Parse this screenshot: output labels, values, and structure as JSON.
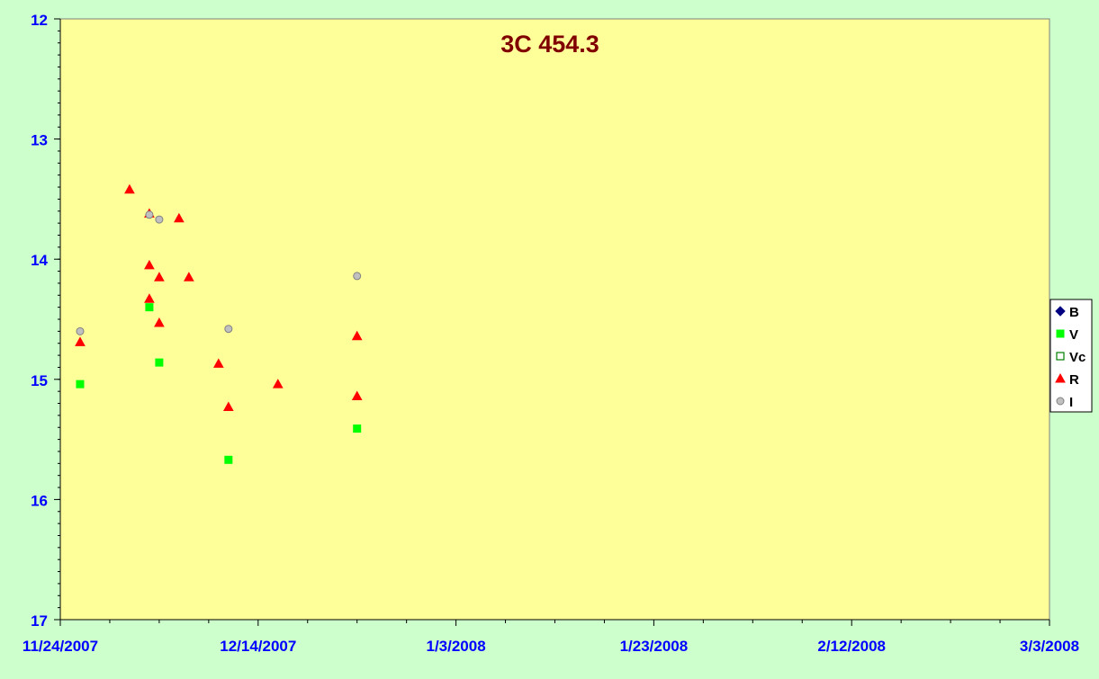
{
  "chart_data": {
    "type": "scatter",
    "title": "3C 454.3",
    "xlabel": "",
    "ylabel": "",
    "x_axis": {
      "type": "date",
      "min": "11/24/2007",
      "max": "3/3/2008",
      "major_tick_labels": [
        "11/24/2007",
        "12/14/2007",
        "1/3/2008",
        "1/23/2008",
        "2/12/2008",
        "3/3/2008"
      ],
      "minor_ticks_per_major": 4
    },
    "y_axis": {
      "min": 12,
      "max": 17,
      "reversed": true,
      "major_tick_labels": [
        "12",
        "13",
        "14",
        "15",
        "16",
        "17"
      ],
      "minor_step": 0.1
    },
    "grid": false,
    "legend_placement": "right",
    "colors": {
      "page_background": "#ccffcc",
      "plot_background": "#ffff99",
      "title": "#800000",
      "tick_labels": "#0000ff",
      "B": "#000080",
      "V": "#00ff00",
      "Vc": "#008000",
      "R": "#ff0000",
      "I": "#c0c0c0"
    },
    "series": [
      {
        "name": "B",
        "marker": "diamond",
        "points": []
      },
      {
        "name": "V",
        "marker": "square",
        "points": [
          {
            "x": "11/26/2007",
            "y": 15.04
          },
          {
            "x": "12/3/2007",
            "y": 14.4
          },
          {
            "x": "12/4/2007",
            "y": 14.86
          },
          {
            "x": "12/11/2007",
            "y": 15.67
          },
          {
            "x": "12/24/2007",
            "y": 15.41
          }
        ]
      },
      {
        "name": "Vc",
        "marker": "square-open",
        "points": []
      },
      {
        "name": "R",
        "marker": "triangle",
        "points": [
          {
            "x": "11/26/2007",
            "y": 14.69
          },
          {
            "x": "12/1/2007",
            "y": 13.42
          },
          {
            "x": "12/3/2007",
            "y": 13.62
          },
          {
            "x": "12/3/2007",
            "y": 14.05
          },
          {
            "x": "12/3/2007",
            "y": 14.33
          },
          {
            "x": "12/4/2007",
            "y": 14.15
          },
          {
            "x": "12/4/2007",
            "y": 14.53
          },
          {
            "x": "12/6/2007",
            "y": 13.66
          },
          {
            "x": "12/7/2007",
            "y": 14.15
          },
          {
            "x": "12/10/2007",
            "y": 14.87
          },
          {
            "x": "12/11/2007",
            "y": 15.23
          },
          {
            "x": "12/16/2007",
            "y": 15.04
          },
          {
            "x": "12/24/2007",
            "y": 14.64
          },
          {
            "x": "12/24/2007",
            "y": 15.14
          }
        ]
      },
      {
        "name": "I",
        "marker": "circle",
        "points": [
          {
            "x": "11/26/2007",
            "y": 14.6
          },
          {
            "x": "12/3/2007",
            "y": 13.63
          },
          {
            "x": "12/4/2007",
            "y": 13.67
          },
          {
            "x": "12/11/2007",
            "y": 14.58
          },
          {
            "x": "12/24/2007",
            "y": 14.14
          }
        ]
      }
    ]
  }
}
